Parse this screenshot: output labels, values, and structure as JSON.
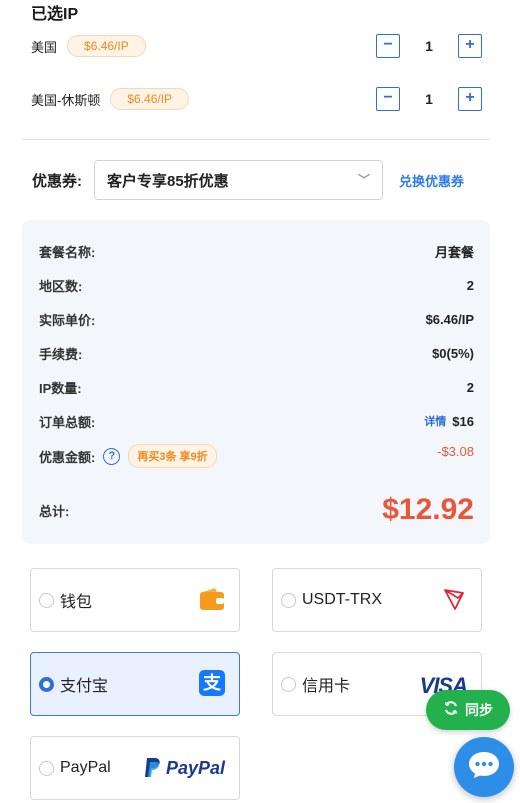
{
  "section_title": "已选IP",
  "ip_items": [
    {
      "name": "美国",
      "price": "$6.46/IP",
      "qty": "1"
    },
    {
      "name": "美国-休斯顿",
      "price": "$6.46/IP",
      "qty": "1"
    }
  ],
  "stepper": {
    "minus": "−",
    "plus": "+"
  },
  "coupon": {
    "label": "优惠券:",
    "selected": "客户专享85折优惠",
    "chevron": "﹀",
    "switch_link": "兑换优惠券"
  },
  "summary": {
    "package_label": "套餐名称:",
    "package_value": "月套餐",
    "region_label": "地区数:",
    "region_value": "2",
    "unit_price_label": "实际单价:",
    "unit_price_value": "$6.46/IP",
    "fee_label": "手续费:",
    "fee_value": "$0(5%)",
    "ip_count_label": "IP数量:",
    "ip_count_value": "2",
    "order_total_label": "订单总额:",
    "order_detail_link": "详情",
    "order_total_value": "$16",
    "discount_label": "优惠金额:",
    "discount_help": "?",
    "discount_promo": "再买3条 享9折",
    "discount_value": "-$3.08",
    "total_label": "总计:",
    "total_value": "$12.92"
  },
  "payment_methods": [
    {
      "label": "钱包",
      "icon": "wallet-icon",
      "selected": false
    },
    {
      "label": "USDT-TRX",
      "icon": "tron-icon",
      "selected": false
    },
    {
      "label": "支付宝",
      "icon": "alipay-icon",
      "selected": true
    },
    {
      "label": "信用卡",
      "icon": "visa-icon",
      "selected": false
    },
    {
      "label": "PayPal",
      "icon": "paypal-icon",
      "selected": false
    }
  ],
  "logos": {
    "visa": "VISA",
    "paypal": "PayPal",
    "alipay": "支"
  },
  "sync_button": {
    "label": "同步",
    "icon": "refresh-icon"
  },
  "chat_button": {
    "icon": "chat-bubble-icon"
  },
  "colors": {
    "accent": "#2e6fd8",
    "price_orange": "#f08a1c",
    "total_red": "#e9573b",
    "sync_green": "#22b14c"
  }
}
